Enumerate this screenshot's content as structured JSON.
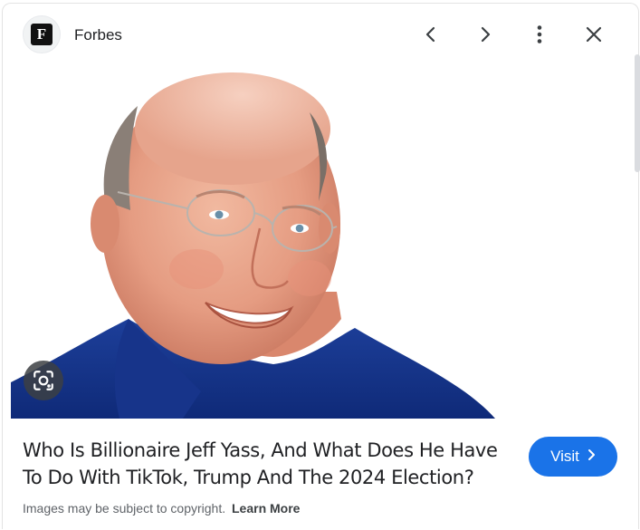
{
  "header": {
    "favicon_letter": "F",
    "source_name": "Forbes",
    "icons": [
      "chevron-left-icon",
      "chevron-right-icon",
      "more-vert-icon",
      "close-icon"
    ]
  },
  "image": {
    "alt": "Who Is Billionaire Jeff Yass, And What Does He Have To Do With TikTok, Trump And The 2024 Election?",
    "lens_icon": "lens-icon"
  },
  "footer": {
    "title": "Who Is Billionaire Jeff Yass, And What Does He Have To Do With TikTok, Trump And The 2024 Election?",
    "visit_label": "Visit",
    "copyright_text": "Images may be subject to copyright.",
    "learn_more_label": "Learn More"
  },
  "colors": {
    "accent": "#1a73e8",
    "text": "#202124",
    "muted": "#5f6368"
  }
}
